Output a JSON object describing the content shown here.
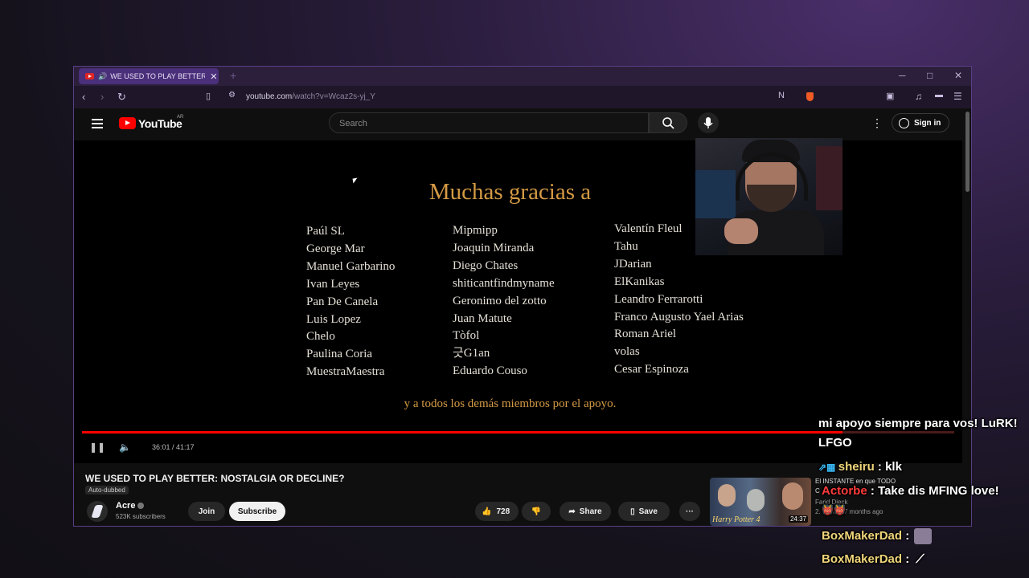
{
  "browser": {
    "tab_title": "WE USED TO PLAY BETTER: N",
    "tab_speaker": "🔊",
    "tab_close": "✕",
    "new_tab": "+",
    "url_host": "youtube.com",
    "url_path": "/watch?v=Wcaz2s-yj_Y",
    "window_controls": [
      "─",
      "□",
      "✕"
    ]
  },
  "youtube": {
    "logo_text": "YouTube",
    "region": "AR",
    "search_placeholder": "Search",
    "signin_label": "Sign in"
  },
  "credits": {
    "title": "Muchas gracias a",
    "col1": [
      "Paúl SL",
      "George Mar",
      "Manuel Garbarino",
      "Ivan Leyes",
      "Pan De Canela",
      "Luis Lopez",
      "Chelo",
      "Paulina Coria",
      "MuestraMaestra"
    ],
    "col2": [
      "Mipmipp",
      "Joaquin Miranda",
      "Diego Chates",
      "shiticantfindmyname",
      "Geronimo del zotto",
      "Juan Matute",
      "Tòfol",
      "긋G1an",
      "Eduardo Couso"
    ],
    "col3": [
      "Valentín Fleul",
      "Tahu",
      "JDarian",
      "ElKanikas",
      "Leandro Ferrarotti",
      "Franco Augusto Yael Arias",
      "Roman Ariel",
      "volas",
      "Cesar Espinoza"
    ],
    "footer": "y a todos los demás miembros por el apoyo."
  },
  "player": {
    "time": "36:01 / 41:17",
    "progress": 0.872
  },
  "video": {
    "title": "WE USED TO PLAY BETTER: NOSTALGIA OR DECLINE?",
    "auto_dubbed": "Auto-dubbed",
    "channel": "Acre",
    "subscribers": "523K subscribers",
    "join_label": "Join",
    "subscribe_label": "Subscribe",
    "likes": "728",
    "share_label": "Share",
    "save_label": "Save",
    "more_label": "···"
  },
  "recommended": {
    "title_line1": "El INSTANTE en que TODO",
    "title_line2": "C",
    "channel": "Farid Dieck",
    "meta": "2.   views · 7 months ago",
    "thumb_text": "Harry Potter 4",
    "duration": "24:37"
  },
  "chat": [
    {
      "user": "",
      "message": "mi apoyo siempre para vos! LuRK!"
    },
    {
      "user": "",
      "message": "LFGO"
    },
    {
      "user": "sheiru",
      "message": " : klk"
    },
    {
      "user": "Actorbe",
      "message": " : Take dis MFING love!"
    },
    {
      "user": "BoxMakerDad",
      "message": " :"
    },
    {
      "user": "BoxMakerDad",
      "message": " :"
    }
  ]
}
